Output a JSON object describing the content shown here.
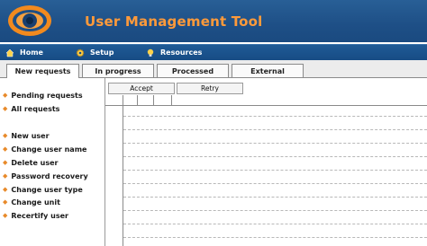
{
  "app": {
    "title": "User Management Tool"
  },
  "menu": [
    {
      "label": "Home",
      "icon": "home-icon"
    },
    {
      "label": "Setup",
      "icon": "gear-icon"
    },
    {
      "label": "Resources",
      "icon": "lightbulb-icon"
    }
  ],
  "tabs": [
    {
      "label": "New requests",
      "active": true
    },
    {
      "label": "In progress",
      "active": false
    },
    {
      "label": "Processed",
      "active": false
    },
    {
      "label": "External",
      "active": false
    }
  ],
  "sidebar": {
    "requests": [
      "Pending requests",
      "All requests"
    ],
    "actions": [
      "New user",
      "Change user name",
      "Delete user",
      "Password recovery",
      "Change user type",
      "Change unit",
      "Recertify user"
    ]
  },
  "buttons": {
    "accept": "Accept",
    "retry": "Retry"
  },
  "colors": {
    "header": "#1e4f86",
    "title": "#ff9a3a",
    "bullet": "#e88a2a"
  }
}
